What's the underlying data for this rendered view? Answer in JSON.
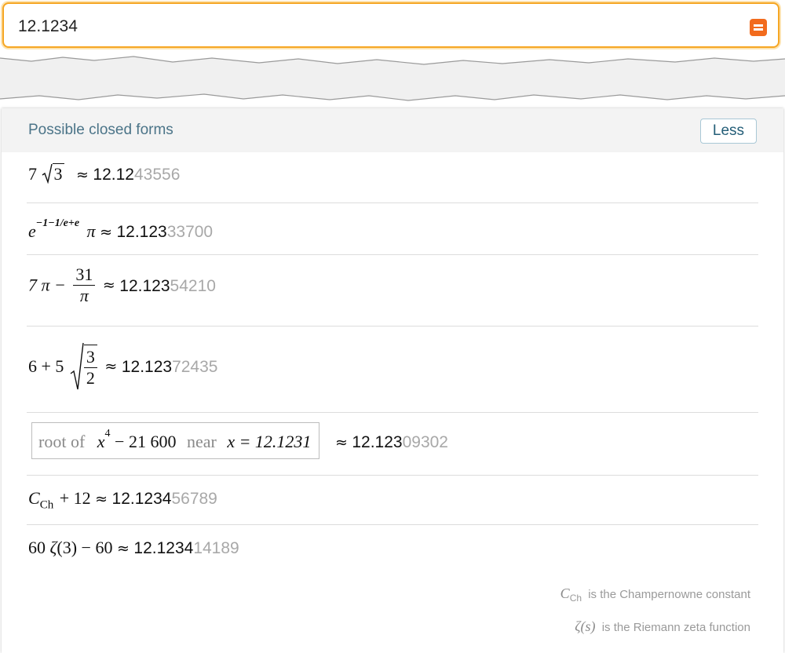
{
  "search": {
    "value": "12.1234",
    "submit_label": "="
  },
  "panel": {
    "title": "Possible closed forms",
    "less_label": "Less"
  },
  "results": [
    {
      "main": "12.12",
      "rest": "43556"
    },
    {
      "main": "12.123",
      "rest": "33700"
    },
    {
      "main": "12.123",
      "rest": "54210"
    },
    {
      "main": "12.123",
      "rest": "72435"
    },
    {
      "main": "12.123",
      "rest": "09302"
    },
    {
      "main": "12.1234",
      "rest": "56789"
    },
    {
      "main": "12.1234",
      "rest": "14189"
    }
  ],
  "formulas": {
    "f1_coef": "7",
    "f1_rad": "3",
    "f2_base": "e",
    "f2_exp": "−1−1/e+e",
    "f2_pi": "π",
    "f3_a": "7 π −",
    "f3_num": "31",
    "f3_den": "π",
    "f4_a": "6 + 5",
    "f4_num": "3",
    "f4_den": "2",
    "f5_root_of": "root of",
    "f5_x": "x",
    "f5_exp": "4",
    "f5_poly": "− 21 600",
    "f5_near": "near",
    "f5_eq": "x = 12.1231",
    "f6_c": "C",
    "f6_sub": "Ch",
    "f6_rest": "+ 12",
    "f7_a": "60",
    "f7_zeta": "ζ",
    "f7_rest": "(3) − 60"
  },
  "approx_symbol": "≈",
  "footnotes": {
    "champernowne_sym": "C",
    "champernowne_sub": "Ch",
    "champernowne_text": "is the Champernowne constant",
    "zeta_sym": "ζ(s)",
    "zeta_text": "is the Riemann zeta function"
  },
  "colors": {
    "accent_orange": "#f26b1d",
    "search_border": "#f6a623",
    "title_blue": "#4b7488"
  }
}
